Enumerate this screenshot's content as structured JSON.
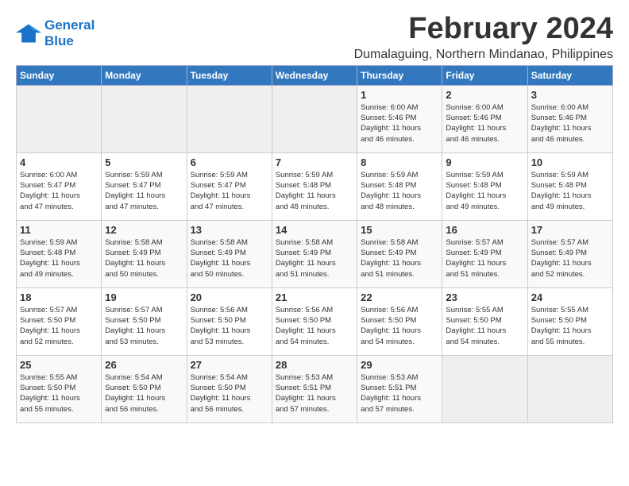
{
  "logo": {
    "line1": "General",
    "line2": "Blue"
  },
  "title": "February 2024",
  "location": "Dumalaguing, Northern Mindanao, Philippines",
  "headers": [
    "Sunday",
    "Monday",
    "Tuesday",
    "Wednesday",
    "Thursday",
    "Friday",
    "Saturday"
  ],
  "weeks": [
    [
      {
        "day": "",
        "info": ""
      },
      {
        "day": "",
        "info": ""
      },
      {
        "day": "",
        "info": ""
      },
      {
        "day": "",
        "info": ""
      },
      {
        "day": "1",
        "info": "Sunrise: 6:00 AM\nSunset: 5:46 PM\nDaylight: 11 hours\nand 46 minutes."
      },
      {
        "day": "2",
        "info": "Sunrise: 6:00 AM\nSunset: 5:46 PM\nDaylight: 11 hours\nand 46 minutes."
      },
      {
        "day": "3",
        "info": "Sunrise: 6:00 AM\nSunset: 5:46 PM\nDaylight: 11 hours\nand 46 minutes."
      }
    ],
    [
      {
        "day": "4",
        "info": "Sunrise: 6:00 AM\nSunset: 5:47 PM\nDaylight: 11 hours\nand 47 minutes."
      },
      {
        "day": "5",
        "info": "Sunrise: 5:59 AM\nSunset: 5:47 PM\nDaylight: 11 hours\nand 47 minutes."
      },
      {
        "day": "6",
        "info": "Sunrise: 5:59 AM\nSunset: 5:47 PM\nDaylight: 11 hours\nand 47 minutes."
      },
      {
        "day": "7",
        "info": "Sunrise: 5:59 AM\nSunset: 5:48 PM\nDaylight: 11 hours\nand 48 minutes."
      },
      {
        "day": "8",
        "info": "Sunrise: 5:59 AM\nSunset: 5:48 PM\nDaylight: 11 hours\nand 48 minutes."
      },
      {
        "day": "9",
        "info": "Sunrise: 5:59 AM\nSunset: 5:48 PM\nDaylight: 11 hours\nand 49 minutes."
      },
      {
        "day": "10",
        "info": "Sunrise: 5:59 AM\nSunset: 5:48 PM\nDaylight: 11 hours\nand 49 minutes."
      }
    ],
    [
      {
        "day": "11",
        "info": "Sunrise: 5:59 AM\nSunset: 5:48 PM\nDaylight: 11 hours\nand 49 minutes."
      },
      {
        "day": "12",
        "info": "Sunrise: 5:58 AM\nSunset: 5:49 PM\nDaylight: 11 hours\nand 50 minutes."
      },
      {
        "day": "13",
        "info": "Sunrise: 5:58 AM\nSunset: 5:49 PM\nDaylight: 11 hours\nand 50 minutes."
      },
      {
        "day": "14",
        "info": "Sunrise: 5:58 AM\nSunset: 5:49 PM\nDaylight: 11 hours\nand 51 minutes."
      },
      {
        "day": "15",
        "info": "Sunrise: 5:58 AM\nSunset: 5:49 PM\nDaylight: 11 hours\nand 51 minutes."
      },
      {
        "day": "16",
        "info": "Sunrise: 5:57 AM\nSunset: 5:49 PM\nDaylight: 11 hours\nand 51 minutes."
      },
      {
        "day": "17",
        "info": "Sunrise: 5:57 AM\nSunset: 5:49 PM\nDaylight: 11 hours\nand 52 minutes."
      }
    ],
    [
      {
        "day": "18",
        "info": "Sunrise: 5:57 AM\nSunset: 5:50 PM\nDaylight: 11 hours\nand 52 minutes."
      },
      {
        "day": "19",
        "info": "Sunrise: 5:57 AM\nSunset: 5:50 PM\nDaylight: 11 hours\nand 53 minutes."
      },
      {
        "day": "20",
        "info": "Sunrise: 5:56 AM\nSunset: 5:50 PM\nDaylight: 11 hours\nand 53 minutes."
      },
      {
        "day": "21",
        "info": "Sunrise: 5:56 AM\nSunset: 5:50 PM\nDaylight: 11 hours\nand 54 minutes."
      },
      {
        "day": "22",
        "info": "Sunrise: 5:56 AM\nSunset: 5:50 PM\nDaylight: 11 hours\nand 54 minutes."
      },
      {
        "day": "23",
        "info": "Sunrise: 5:55 AM\nSunset: 5:50 PM\nDaylight: 11 hours\nand 54 minutes."
      },
      {
        "day": "24",
        "info": "Sunrise: 5:55 AM\nSunset: 5:50 PM\nDaylight: 11 hours\nand 55 minutes."
      }
    ],
    [
      {
        "day": "25",
        "info": "Sunrise: 5:55 AM\nSunset: 5:50 PM\nDaylight: 11 hours\nand 55 minutes."
      },
      {
        "day": "26",
        "info": "Sunrise: 5:54 AM\nSunset: 5:50 PM\nDaylight: 11 hours\nand 56 minutes."
      },
      {
        "day": "27",
        "info": "Sunrise: 5:54 AM\nSunset: 5:50 PM\nDaylight: 11 hours\nand 56 minutes."
      },
      {
        "day": "28",
        "info": "Sunrise: 5:53 AM\nSunset: 5:51 PM\nDaylight: 11 hours\nand 57 minutes."
      },
      {
        "day": "29",
        "info": "Sunrise: 5:53 AM\nSunset: 5:51 PM\nDaylight: 11 hours\nand 57 minutes."
      },
      {
        "day": "",
        "info": ""
      },
      {
        "day": "",
        "info": ""
      }
    ]
  ]
}
